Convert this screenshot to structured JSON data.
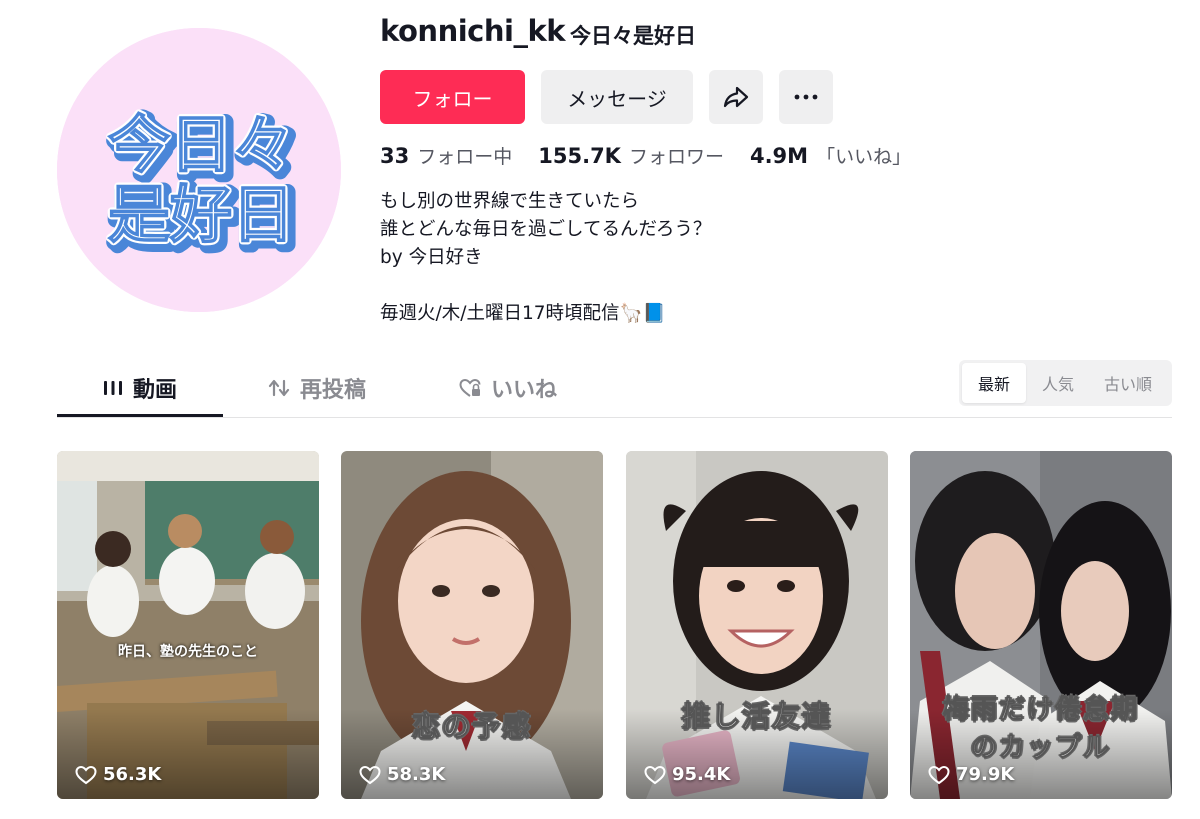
{
  "profile": {
    "username": "konnichi_kk",
    "nickname": "今日々是好日",
    "avatar_text": [
      "今日々",
      "是好日"
    ],
    "follow_label": "フォロー",
    "message_label": "メッセージ",
    "share_icon": "share-icon",
    "more_icon": "more-dots-icon"
  },
  "stats": {
    "following_count": "33",
    "following_label": "フォロー中",
    "followers_count": "155.7K",
    "followers_label": "フォロワー",
    "likes_count": "4.9M",
    "likes_label": "「いいね」"
  },
  "bio": {
    "lines": [
      "もし別の世界線で生きていたら",
      "誰とどんな毎日を過ごしてるんだろう？",
      "by 今日好き",
      "",
      "毎週火/木/土曜日17時頃配信🦙📘"
    ]
  },
  "tabs": [
    {
      "label": "動画",
      "icon": "grid-icon",
      "active": true
    },
    {
      "label": "再投稿",
      "icon": "repost-icon",
      "active": false
    },
    {
      "label": "いいね",
      "icon": "heart-lock-icon",
      "active": false
    }
  ],
  "sort": {
    "options": [
      "最新",
      "人気",
      "古い順"
    ],
    "selected": "最新"
  },
  "videos": [
    {
      "caption": "昨日、塾の先生のこと",
      "likes": "56.3K"
    },
    {
      "caption": "恋の予感",
      "likes": "58.3K"
    },
    {
      "caption": "推し活友達",
      "likes": "95.4K"
    },
    {
      "caption_line1": "梅雨だけ倦怠期",
      "caption_line2": "のカップル",
      "likes": "79.9K"
    }
  ],
  "colors": {
    "accent": "#fe2c55",
    "avatar_bg": "#fbe0f8",
    "avatar_text": "#4a86d8"
  }
}
